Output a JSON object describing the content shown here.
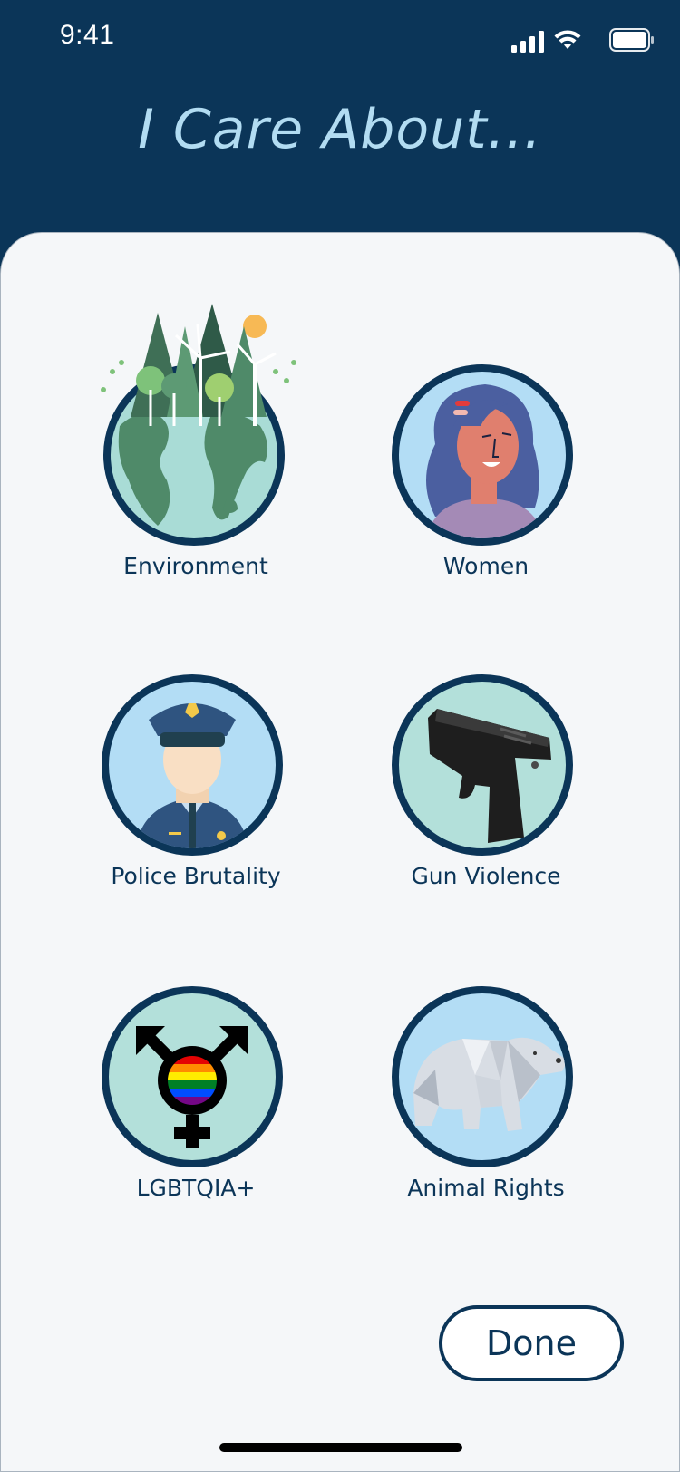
{
  "status_bar": {
    "time": "9:41",
    "icons": [
      "cellular-signal-icon",
      "wifi-icon",
      "battery-icon"
    ]
  },
  "header": {
    "title": "I Care About..."
  },
  "causes": [
    {
      "label": "Environment",
      "icon": "earth-forest-windmill-illustration",
      "bg": "#a9dcd6"
    },
    {
      "label": "Women",
      "icon": "woman-portrait-illustration",
      "bg": "#b3ddf5"
    },
    {
      "label": "Police Brutality",
      "icon": "police-officer-illustration",
      "bg": "#b3ddf5"
    },
    {
      "label": "Gun Violence",
      "icon": "handgun-illustration",
      "bg": "#b3e0da"
    },
    {
      "label": "LGBTQIA+",
      "icon": "transgender-symbol-rainbow-illustration",
      "bg": "#b3e0da"
    },
    {
      "label": "Animal Rights",
      "icon": "polar-bear-illustration",
      "bg": "#b3ddf5"
    }
  ],
  "actions": {
    "done_label": "Done"
  },
  "colors": {
    "primary": "#0b3558",
    "title": "#b2dcf2",
    "sheet_bg": "#f5f7f9"
  }
}
